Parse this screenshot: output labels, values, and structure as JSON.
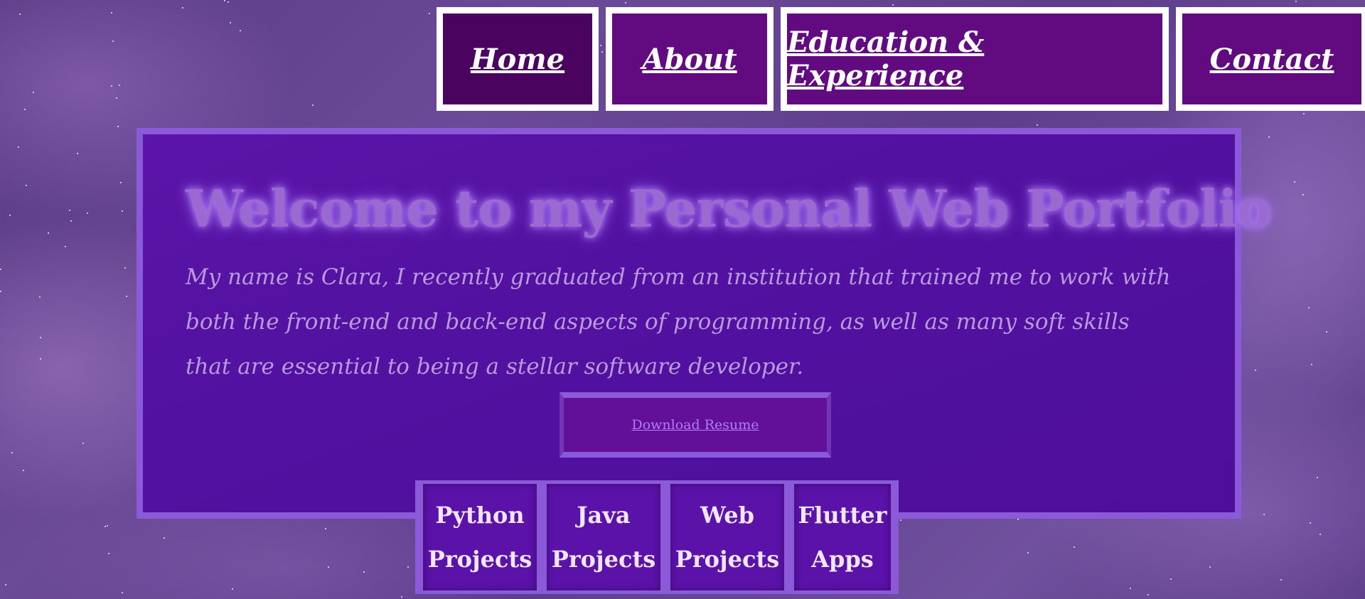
{
  "nav": {
    "items": [
      {
        "label": "Home",
        "active": true
      },
      {
        "label": "About"
      },
      {
        "label": "Education & Experience"
      },
      {
        "label": "Contact"
      }
    ]
  },
  "hero": {
    "title": "Welcome to my Personal Web Portfolio",
    "text": "My name is Clara, I recently graduated from an institution that trained me to work with both the front-end and back-end aspects of programming, as well as many soft skills that are essential to being a stellar software developer.",
    "download_label": "Download Resume"
  },
  "projects": [
    {
      "line1": "Python",
      "line2": "Projects"
    },
    {
      "line1": "Java",
      "line2": "Projects"
    },
    {
      "line1": "Web",
      "line2": "Projects"
    },
    {
      "line1": "Flutter",
      "line2": "Apps"
    }
  ],
  "colors": {
    "nav_bg": "#620a80",
    "nav_active_bg": "#4a045f",
    "panel_bg": "#5211a0",
    "panel_border": "#8a5ad8",
    "title_glow": "#9a6ad0"
  }
}
